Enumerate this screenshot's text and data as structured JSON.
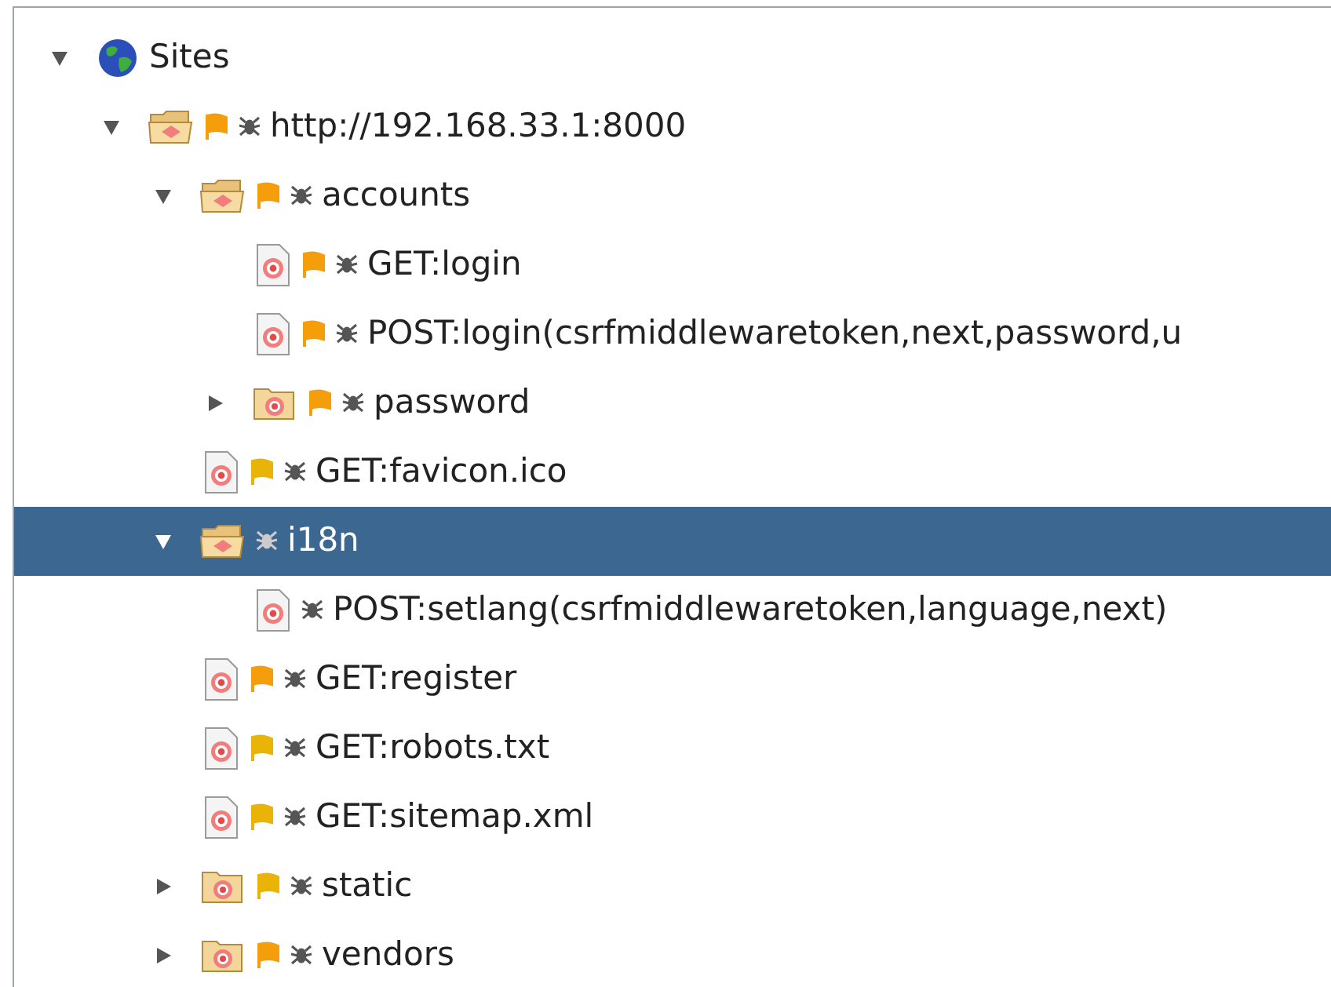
{
  "tree": [
    {
      "label": "Sites",
      "kind": "root",
      "expanded": true,
      "selected": false,
      "children": [
        {
          "label": "http://192.168.33.1:8000",
          "kind": "folder",
          "expanded": true,
          "selected": false,
          "spider": true,
          "flag": {
            "color": "#f59e0b"
          },
          "children": [
            {
              "label": "accounts",
              "kind": "folder",
              "expanded": true,
              "selected": false,
              "spider": true,
              "flag": {
                "color": "#f59e0b"
              },
              "children": [
                {
                  "label": "GET:login",
                  "kind": "file",
                  "selected": false,
                  "spider": true,
                  "flag": {
                    "color": "#f59e0b"
                  }
                },
                {
                  "label": "POST:login(csrfmiddlewaretoken,next,password,u",
                  "kind": "file",
                  "selected": false,
                  "spider": true,
                  "flag": {
                    "color": "#f59e0b"
                  }
                },
                {
                  "label": "password",
                  "kind": "folder",
                  "expanded": false,
                  "selected": false,
                  "spider": true,
                  "flag": {
                    "color": "#f59e0b"
                  }
                }
              ]
            },
            {
              "label": "GET:favicon.ico",
              "kind": "file",
              "selected": false,
              "spider": true,
              "flag": {
                "color": "#eab308"
              }
            },
            {
              "label": "i18n",
              "kind": "folder",
              "expanded": true,
              "selected": true,
              "spider": true,
              "children": [
                {
                  "label": "POST:setlang(csrfmiddlewaretoken,language,next)",
                  "kind": "file",
                  "selected": false,
                  "spider": true
                }
              ]
            },
            {
              "label": "GET:register",
              "kind": "file",
              "selected": false,
              "spider": true,
              "flag": {
                "color": "#f59e0b"
              }
            },
            {
              "label": "GET:robots.txt",
              "kind": "file",
              "selected": false,
              "spider": true,
              "flag": {
                "color": "#eab308"
              }
            },
            {
              "label": "GET:sitemap.xml",
              "kind": "file",
              "selected": false,
              "spider": true,
              "flag": {
                "color": "#eab308"
              }
            },
            {
              "label": "static",
              "kind": "folder",
              "expanded": false,
              "selected": false,
              "spider": true,
              "flag": {
                "color": "#eab308"
              }
            },
            {
              "label": "vendors",
              "kind": "folder",
              "expanded": false,
              "selected": false,
              "spider": true,
              "flag": {
                "color": "#f59e0b"
              }
            }
          ]
        }
      ]
    }
  ]
}
